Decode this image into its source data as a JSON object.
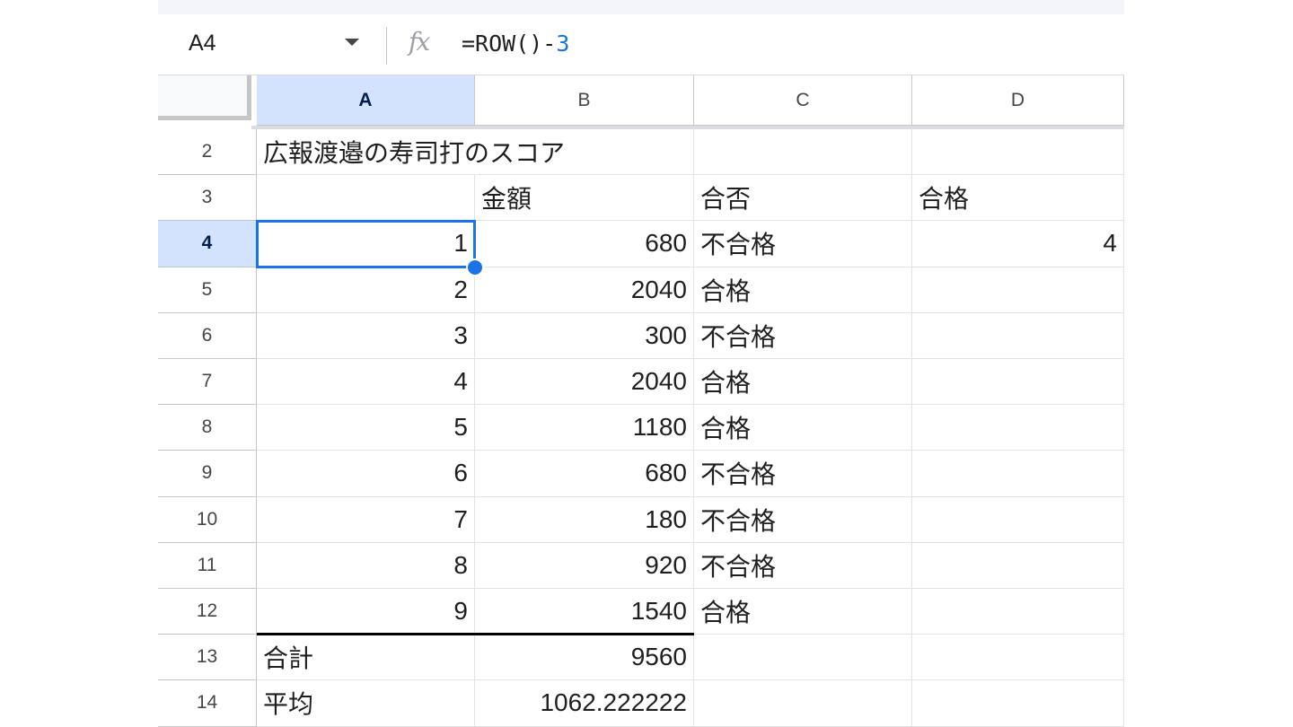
{
  "formula_bar": {
    "name_box": "A4",
    "fx_label": "fx",
    "formula_prefix": "=ROW()-",
    "formula_number": "3"
  },
  "columns": [
    "A",
    "B",
    "C",
    "D"
  ],
  "selected_column": "A",
  "rows": [
    {
      "num": "2",
      "a": "広報渡邉の寿司打のスコア",
      "b": "",
      "c": "",
      "d": ""
    },
    {
      "num": "3",
      "a": "",
      "b": "金額",
      "c": "合否",
      "d": "合格"
    },
    {
      "num": "4",
      "a": "1",
      "b": "680",
      "c": "不合格",
      "d": "4"
    },
    {
      "num": "5",
      "a": "2",
      "b": "2040",
      "c": "合格",
      "d": ""
    },
    {
      "num": "6",
      "a": "3",
      "b": "300",
      "c": "不合格",
      "d": ""
    },
    {
      "num": "7",
      "a": "4",
      "b": "2040",
      "c": "合格",
      "d": ""
    },
    {
      "num": "8",
      "a": "5",
      "b": "1180",
      "c": "合格",
      "d": ""
    },
    {
      "num": "9",
      "a": "6",
      "b": "680",
      "c": "不合格",
      "d": ""
    },
    {
      "num": "10",
      "a": "7",
      "b": "180",
      "c": "不合格",
      "d": ""
    },
    {
      "num": "11",
      "a": "8",
      "b": "920",
      "c": "不合格",
      "d": ""
    },
    {
      "num": "12",
      "a": "9",
      "b": "1540",
      "c": "合格",
      "d": ""
    },
    {
      "num": "13",
      "a": "合計",
      "b": "9560",
      "c": "",
      "d": ""
    },
    {
      "num": "14",
      "a": "平均",
      "b": "1062.222222",
      "c": "",
      "d": ""
    }
  ],
  "selected_row": "4",
  "selected_cell": "A4",
  "colors": {
    "selection": "#1a73e8",
    "header_selected_bg": "#d3e3fd",
    "formula_number": "#1a73e8"
  }
}
